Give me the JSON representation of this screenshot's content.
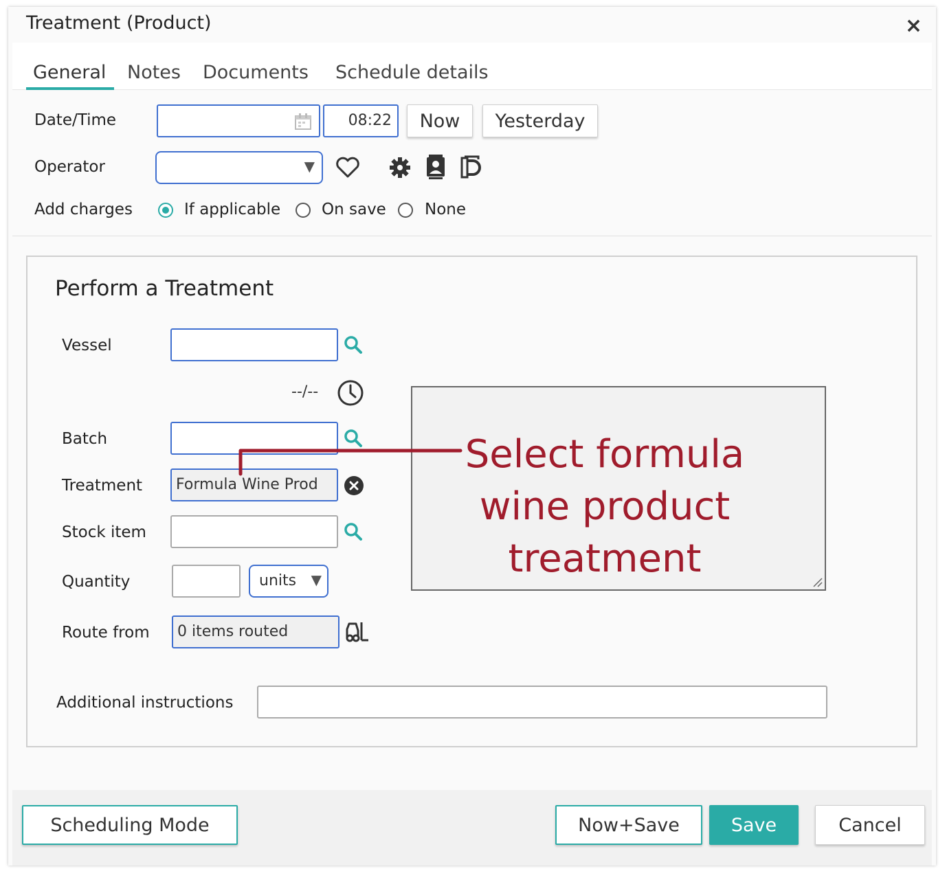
{
  "dialog": {
    "title": "Treatment (Product)",
    "close_symbol": "×"
  },
  "tabs": [
    {
      "label": "General",
      "active": true
    },
    {
      "label": "Notes"
    },
    {
      "label": "Documents"
    },
    {
      "label": "Schedule details"
    }
  ],
  "general": {
    "datetime_label": "Date/Time",
    "date_value": "",
    "time_value": "08:22",
    "now_label": "Now",
    "yesterday_label": "Yesterday",
    "operator_label": "Operator",
    "operator_value": "",
    "add_charges_label": "Add charges",
    "charges_options": [
      {
        "label": "If applicable",
        "selected": true
      },
      {
        "label": "On save",
        "selected": false
      },
      {
        "label": "None",
        "selected": false
      }
    ]
  },
  "treatment_panel": {
    "heading": "Perform a Treatment",
    "vessel_label": "Vessel",
    "vessel_value": "",
    "volume_readout": "--/--",
    "batch_label": "Batch",
    "batch_value": "",
    "treatment_label": "Treatment",
    "treatment_value": "Formula Wine Prod",
    "stock_item_label": "Stock item",
    "stock_item_value": "",
    "quantity_label": "Quantity",
    "quantity_value": "",
    "units_value": "units",
    "route_from_label": "Route from",
    "route_from_value": "0 items routed",
    "additional_instructions_label": "Additional instructions",
    "additional_instructions_value": ""
  },
  "annotation": {
    "text_line1": "Select formula",
    "text_line2": "wine product",
    "text_line3": "treatment",
    "color": "#a01c2c"
  },
  "footer": {
    "scheduling_mode_label": "Scheduling Mode",
    "now_save_label": "Now+Save",
    "save_label": "Save",
    "cancel_label": "Cancel"
  },
  "colors": {
    "accent": "#2aaba6",
    "input_border": "#3f6fd0"
  }
}
